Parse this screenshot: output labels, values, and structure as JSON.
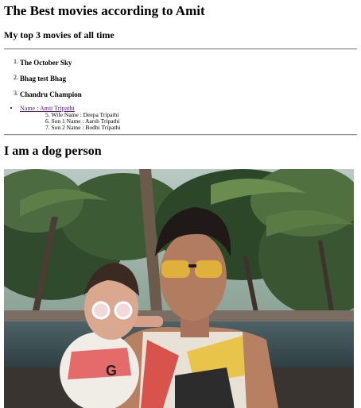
{
  "title": "The Best movies according to Amit",
  "subtitle": "My top 3 movies of all time",
  "movies": [
    {
      "number": "1.",
      "title": "The October Sky"
    },
    {
      "number": "2.",
      "title": "Bhag test Bhag"
    },
    {
      "number": "3.",
      "title": "Chandru Champion"
    }
  ],
  "family": {
    "name_link": "Name : Amit Tripathi",
    "members": [
      "5. Wife Name : Deepa Tripathi",
      "6. Son 1 Name : Aarsh Tripathi",
      "7. Son 2 Name : Bodhi Tripathi"
    ]
  },
  "dog_heading": "I am a dog person",
  "photo_text": "G"
}
